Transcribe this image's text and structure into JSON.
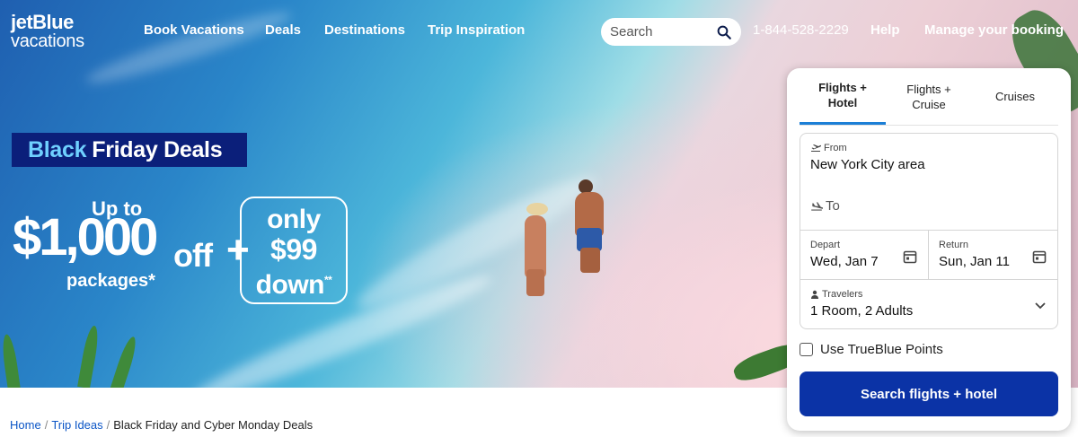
{
  "brand": {
    "line1": "jetBlue",
    "line2": "vacations"
  },
  "nav": {
    "links": [
      "Book Vacations",
      "Deals",
      "Destinations",
      "Trip Inspiration"
    ],
    "search_placeholder": "Search",
    "phone": "1-844-528-2229",
    "help": "Help",
    "manage": "Manage your booking"
  },
  "promo": {
    "badge_highlight": "Black",
    "badge_rest": "Friday Deals",
    "up_to": "Up to",
    "amount": "$1,000",
    "off": "off",
    "packages": "packages*",
    "plus": "+",
    "only": "only",
    "down_amount": "$99",
    "down": "down",
    "down_mark": "**"
  },
  "booking": {
    "tabs": [
      {
        "line1": "Flights +",
        "line2": "Hotel",
        "active": true
      },
      {
        "line1": "Flights +",
        "line2": "Cruise",
        "active": false
      },
      {
        "line1": "Cruises",
        "line2": "",
        "active": false
      }
    ],
    "from_label": "From",
    "from_value": "New York City area",
    "to_label": "To",
    "depart_label": "Depart",
    "depart_value": "Wed, Jan 7",
    "return_label": "Return",
    "return_value": "Sun, Jan 11",
    "travelers_label": "Travelers",
    "travelers_value": "1 Room, 2 Adults",
    "points_label": "Use TrueBlue Points",
    "submit": "Search flights + hotel"
  },
  "breadcrumb": [
    "Home",
    "Trip Ideas",
    "Black Friday and Cyber Monday Deals"
  ],
  "colors": {
    "accent": "#0b33a6",
    "badge_bg": "#0b1f7a",
    "badge_highlight": "#6fd0ff",
    "tab_underline": "#1c7fd6",
    "link": "#0b55c6"
  }
}
